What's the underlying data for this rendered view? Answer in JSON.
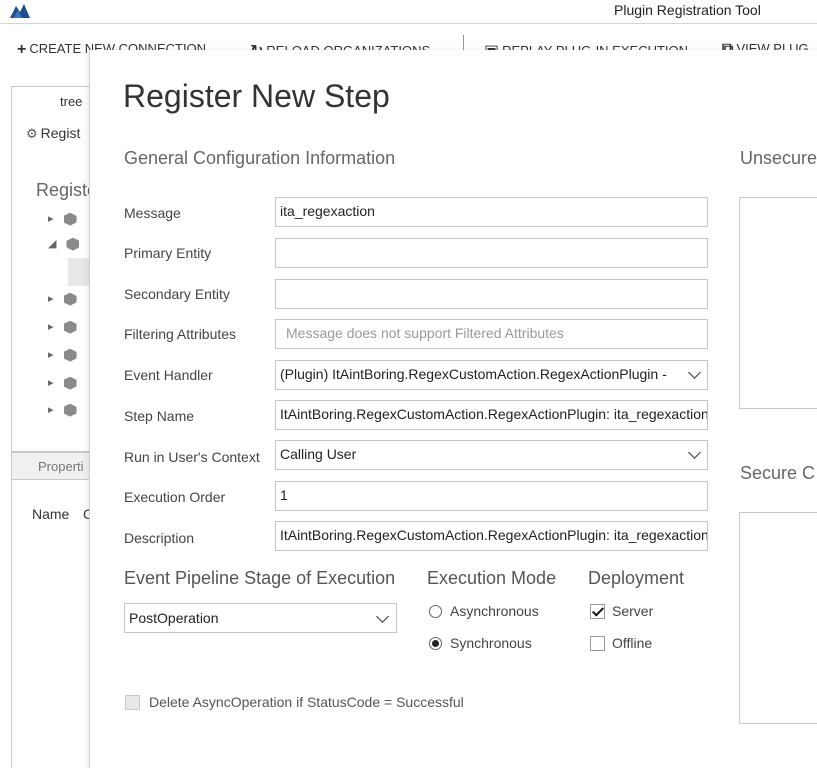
{
  "app": {
    "title": "Plugin Registration Tool"
  },
  "toolbar": {
    "create_connection": "CREATE NEW CONNECTION",
    "reload_organizations": "RELOAD ORGANIZATIONS",
    "replay_plugin_execution": "REPLAY PLUG-IN EXECUTION",
    "view_plugin": "VIEW PLUG"
  },
  "background": {
    "tab_label": "tree",
    "register_button": "Regist",
    "registered_heading": "Registe",
    "properties_label": "Properti",
    "name_column": "Name",
    "second_column": "C"
  },
  "dialog": {
    "title": "Register New Step",
    "general_section": "General Configuration Information",
    "unsecure_section": "Unsecure",
    "secure_section": "Secure  C",
    "fields": {
      "message": {
        "label": "Message",
        "value": "ita_regexaction"
      },
      "primary_entity": {
        "label": "Primary Entity",
        "value": ""
      },
      "secondary_entity": {
        "label": "Secondary Entity",
        "value": ""
      },
      "filtering_attributes": {
        "label": "Filtering Attributes",
        "placeholder": "Message does not support Filtered Attributes"
      },
      "event_handler": {
        "label": "Event Handler",
        "value": "(Plugin) ItAintBoring.RegexCustomAction.RegexActionPlugin - "
      },
      "step_name": {
        "label": "Step Name",
        "value": "ItAintBoring.RegexCustomAction.RegexActionPlugin: ita_regexaction"
      },
      "run_context": {
        "label": "Run in User's Context",
        "value": "Calling User"
      },
      "execution_order": {
        "label": "Execution Order",
        "value": "1"
      },
      "description": {
        "label": "Description",
        "value": "ItAintBoring.RegexCustomAction.RegexActionPlugin: ita_regexaction"
      }
    },
    "pipeline": {
      "heading": "Event Pipeline Stage of Execution",
      "selected": "PostOperation"
    },
    "execution_mode": {
      "heading": "Execution Mode",
      "asynchronous": "Asynchronous",
      "synchronous": "Synchronous",
      "selected": "Synchronous"
    },
    "deployment": {
      "heading": "Deployment",
      "server": "Server",
      "offline": "Offline",
      "server_checked": true,
      "offline_checked": false
    },
    "delete_async": {
      "label": "Delete AsyncOperation if StatusCode = Successful",
      "checked": false
    }
  }
}
